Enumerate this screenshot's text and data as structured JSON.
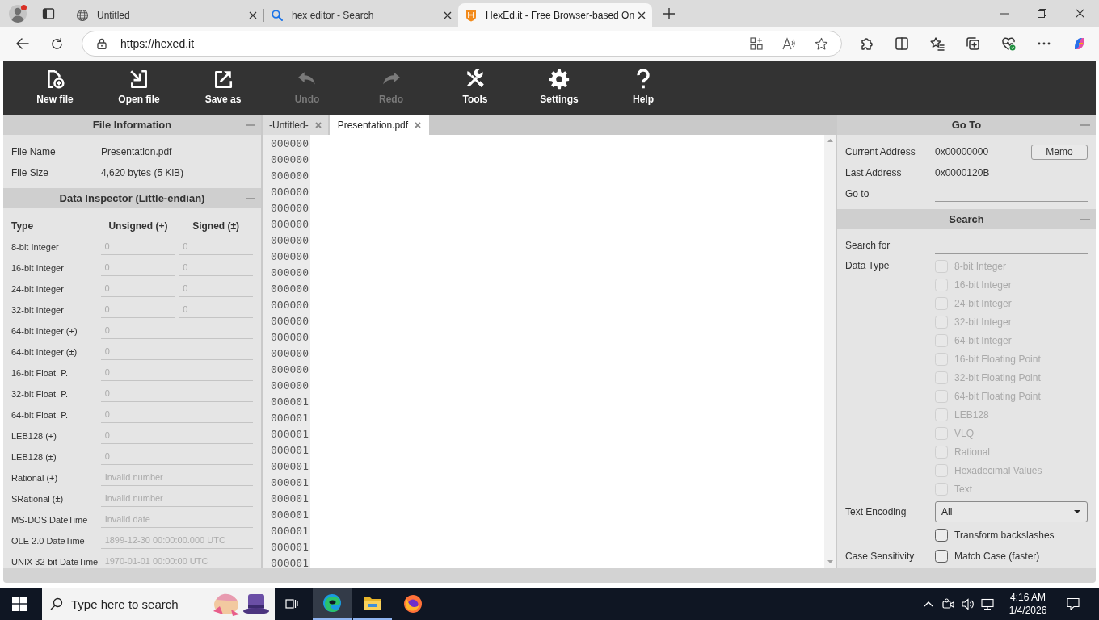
{
  "browser": {
    "tabs": [
      {
        "title": "Untitled",
        "selected": false
      },
      {
        "title": "hex editor - Search",
        "selected": false
      },
      {
        "title": "HexEd.it - Free Browser-based On",
        "selected": true
      }
    ],
    "address": "https://hexed.it"
  },
  "toolbar": [
    {
      "label": "New file",
      "disabled": false
    },
    {
      "label": "Open file",
      "disabled": false
    },
    {
      "label": "Save as",
      "disabled": false
    },
    {
      "label": "Undo",
      "disabled": true
    },
    {
      "label": "Redo",
      "disabled": true
    },
    {
      "label": "Tools",
      "disabled": false
    },
    {
      "label": "Settings",
      "disabled": false
    },
    {
      "label": "Help",
      "disabled": false
    }
  ],
  "file_information": {
    "title": "File Information",
    "rows": [
      {
        "label": "File Name",
        "value": "Presentation.pdf"
      },
      {
        "label": "File Size",
        "value": "4,620 bytes (5 KiB)"
      }
    ]
  },
  "data_inspector": {
    "title": "Data Inspector (Little-endian)",
    "disabled": true,
    "columns": [
      "Type",
      "Unsigned (+)",
      "Signed (±)"
    ],
    "rows": [
      {
        "type": "8-bit Integer",
        "values": [
          "0",
          "0"
        ]
      },
      {
        "type": "16-bit Integer",
        "values": [
          "0",
          "0"
        ]
      },
      {
        "type": "24-bit Integer",
        "values": [
          "0",
          "0"
        ]
      },
      {
        "type": "32-bit Integer",
        "values": [
          "0",
          "0"
        ]
      },
      {
        "type": "64-bit Integer (+)",
        "values": [
          "0"
        ]
      },
      {
        "type": "64-bit Integer (±)",
        "values": [
          "0"
        ]
      },
      {
        "type": "16-bit Float. P.",
        "values": [
          "0"
        ]
      },
      {
        "type": "32-bit Float. P.",
        "values": [
          "0"
        ]
      },
      {
        "type": "64-bit Float. P.",
        "values": [
          "0"
        ]
      },
      {
        "type": "LEB128 (+)",
        "values": [
          "0"
        ]
      },
      {
        "type": "LEB128 (±)",
        "values": [
          "0"
        ]
      },
      {
        "type": "Rational (+)",
        "values": [
          "Invalid number"
        ]
      },
      {
        "type": "SRational (±)",
        "values": [
          "Invalid number"
        ]
      },
      {
        "type": "MS-DOS DateTime",
        "values": [
          "Invalid date"
        ]
      },
      {
        "type": "OLE 2.0 DateTime",
        "values": [
          "1899-12-30 00:00:00.000 UTC"
        ]
      },
      {
        "type": "UNIX 32-bit DateTime",
        "values": [
          "1970-01-01 00:00:00 UTC"
        ]
      }
    ]
  },
  "editor": {
    "tabs": [
      {
        "label": "-Untitled-",
        "selected": false
      },
      {
        "label": "Presentation.pdf",
        "selected": true
      }
    ],
    "offsets": [
      "000000",
      "000000",
      "000000",
      "000000",
      "000000",
      "000000",
      "000000",
      "000000",
      "000000",
      "000000",
      "000000",
      "000000",
      "000000",
      "000000",
      "000000",
      "000000",
      "000001",
      "000001",
      "000001",
      "000001",
      "000001",
      "000001",
      "000001",
      "000001",
      "000001",
      "000001",
      "000001"
    ]
  },
  "go_to": {
    "title": "Go To",
    "current_address": {
      "label": "Current Address",
      "value": "0x00000000"
    },
    "memo_button": "Memo",
    "last_address": {
      "label": "Last Address",
      "value": "0x0000120B"
    },
    "go_to_field": {
      "label": "Go to"
    }
  },
  "search": {
    "title": "Search",
    "search_for": {
      "label": "Search for"
    },
    "data_type": {
      "label": "Data Type",
      "options": [
        {
          "label": "8-bit Integer",
          "checked": false,
          "disabled": true
        },
        {
          "label": "16-bit Integer",
          "checked": false,
          "disabled": true
        },
        {
          "label": "24-bit Integer",
          "checked": false,
          "disabled": true
        },
        {
          "label": "32-bit Integer",
          "checked": false,
          "disabled": true
        },
        {
          "label": "64-bit Integer",
          "checked": false,
          "disabled": true
        },
        {
          "label": "16-bit Floating Point",
          "checked": false,
          "disabled": true
        },
        {
          "label": "32-bit Floating Point",
          "checked": false,
          "disabled": true
        },
        {
          "label": "64-bit Floating Point",
          "checked": false,
          "disabled": true
        },
        {
          "label": "LEB128",
          "checked": false,
          "disabled": true
        },
        {
          "label": "VLQ",
          "checked": false,
          "disabled": true
        },
        {
          "label": "Rational",
          "checked": false,
          "disabled": true
        },
        {
          "label": "Hexadecimal Values",
          "checked": false,
          "disabled": true
        },
        {
          "label": "Text",
          "checked": false,
          "disabled": true
        }
      ]
    },
    "text_encoding": {
      "label": "Text Encoding",
      "value": "All"
    },
    "transform_backslashes": {
      "label": "Transform backslashes",
      "checked": false
    },
    "case_sensitivity": {
      "label": "Case Sensitivity",
      "option": "Match Case (faster)",
      "checked": false
    }
  },
  "taskbar": {
    "search_placeholder": "Type here to search",
    "time": "4:16 AM",
    "date": "1/4/2026"
  }
}
